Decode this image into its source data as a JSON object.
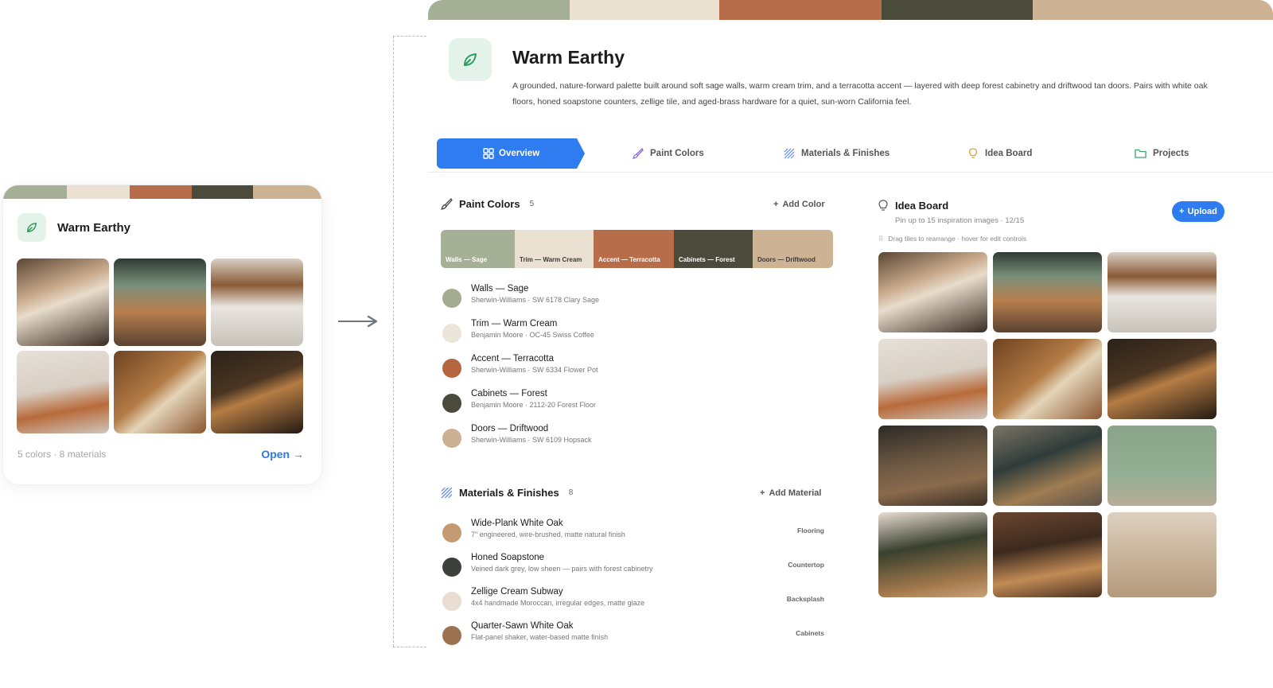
{
  "palette": {
    "name": "Warm Earthy",
    "colors": [
      "#a5b096",
      "#ebe1d3",
      "#b76d4a",
      "#4a4b3a",
      "#cdb394"
    ],
    "description": "A grounded, nature-forward palette built around soft sage walls, warm cream trim, and a terracotta accent — layered with deep forest cabinetry and driftwood tan doors. Pairs with white oak floors, honed soapstone counters, zellige tile, and aged-brass hardware for a quiet, sun-worn California feel."
  },
  "card": {
    "meta": "5 colors · 8 materials",
    "open_label": "Open →"
  },
  "tabs": [
    {
      "label": "Overview",
      "icon": "grid-icon",
      "active": true
    },
    {
      "label": "Paint Colors",
      "icon": "paintbrush-icon",
      "active": false
    },
    {
      "label": "Materials & Finishes",
      "icon": "texture-icon",
      "active": false
    },
    {
      "label": "Idea Board",
      "icon": "lightbulb-icon",
      "active": false
    },
    {
      "label": "Projects",
      "icon": "folder-icon",
      "active": false
    }
  ],
  "paint_colors": {
    "title": "Paint Colors",
    "count": "5",
    "add_label": "Add Color",
    "swatches": [
      {
        "label": "Walls — Sage",
        "color": "#a5b096",
        "text_color": "#ffffff"
      },
      {
        "label": "Trim — Warm Cream",
        "color": "#ebe1d3",
        "text_color": "#3a3a3a"
      },
      {
        "label": "Accent — Terracotta",
        "color": "#b76d4a",
        "text_color": "#ffffff"
      },
      {
        "label": "Cabinets — Forest",
        "color": "#4a4b3a",
        "text_color": "#ffffff"
      },
      {
        "label": "Doors — Driftwood",
        "color": "#cdb394",
        "text_color": "#3a3a3a"
      }
    ],
    "items": [
      {
        "name": "Walls — Sage",
        "detail": "Sherwin-Williams · SW 6178 Clary Sage",
        "color": "#a5ab8f"
      },
      {
        "name": "Trim — Warm Cream",
        "detail": "Benjamin Moore · OC-45 Swiss Coffee",
        "color": "#ece5d9"
      },
      {
        "name": "Accent — Terracotta",
        "detail": "Sherwin-Williams · SW 6334 Flower Pot",
        "color": "#b5653f"
      },
      {
        "name": "Cabinets — Forest",
        "detail": "Benjamin Moore · 2112-20 Forest Floor",
        "color": "#4a4a3d"
      },
      {
        "name": "Doors — Driftwood",
        "detail": "Sherwin-Williams · SW 6109 Hopsack",
        "color": "#cbb091"
      }
    ]
  },
  "materials": {
    "title": "Materials & Finishes",
    "count": "8",
    "add_label": "Add Material",
    "items": [
      {
        "name": "Wide-Plank White Oak",
        "detail": "7\" engineered, wire-brushed, matte natural finish",
        "tag": "Flooring",
        "color": "#c59a72"
      },
      {
        "name": "Honed Soapstone",
        "detail": "Veined dark grey, low sheen — pairs with forest cabinetry",
        "tag": "Countertop",
        "color": "#3e403c"
      },
      {
        "name": "Zellige Cream Subway",
        "detail": "4x4 handmade Moroccan, irregular edges, matte glaze",
        "tag": "Backsplash",
        "color": "#e8ddd0"
      },
      {
        "name": "Quarter-Sawn White Oak",
        "detail": "Flat-panel shaker, water-based matte finish",
        "tag": "Cabinets",
        "color": "#9b7350"
      }
    ]
  },
  "idea_board": {
    "title": "Idea Board",
    "subtitle": "Pin up to 15 inspiration images · 12/15",
    "upload_label": "Upload",
    "hint": "Drag tiles to rearrange · hover for edit controls"
  }
}
